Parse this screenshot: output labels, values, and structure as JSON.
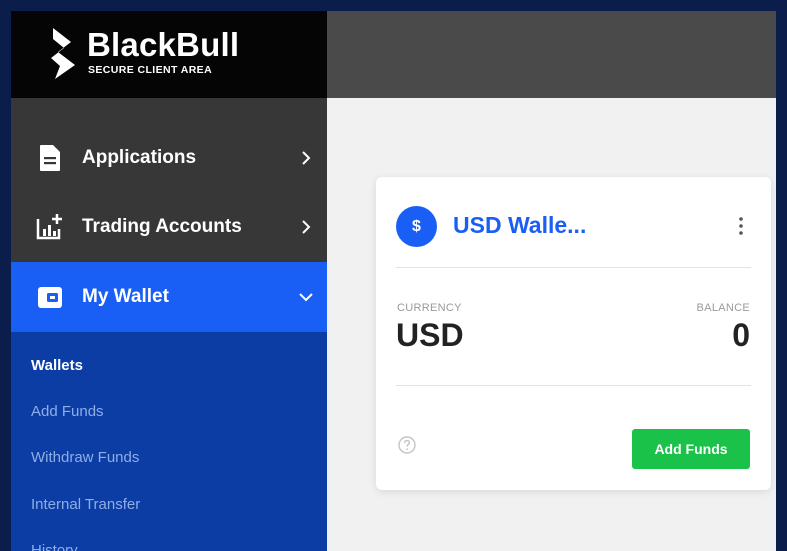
{
  "brand": {
    "name": "BlackBull",
    "subtitle": "SECURE CLIENT AREA"
  },
  "sidebar": {
    "items": [
      {
        "label": "Applications",
        "icon": "document-icon"
      },
      {
        "label": "Trading Accounts",
        "icon": "chart-plus-icon"
      },
      {
        "label": "My Wallet",
        "icon": "wallet-icon"
      }
    ],
    "submenu": [
      {
        "label": "Wallets",
        "active": true
      },
      {
        "label": "Add Funds"
      },
      {
        "label": "Withdraw Funds"
      },
      {
        "label": "Internal Transfer"
      },
      {
        "label": "History"
      }
    ]
  },
  "wallet_card": {
    "icon_symbol": "$",
    "title": "USD Walle...",
    "currency_label": "CURRENCY",
    "currency_value": "USD",
    "balance_label": "BALANCE",
    "balance_value": "0",
    "add_funds_label": "Add Funds"
  },
  "colors": {
    "accent": "#1a5ff5",
    "submenu_bg": "#0c3da5",
    "success": "#1bc24a",
    "outer_bg": "#0b1d4a"
  }
}
